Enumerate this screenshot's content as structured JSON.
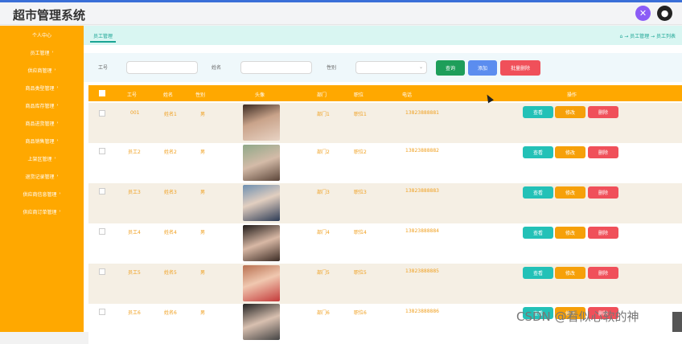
{
  "header": {
    "title": "超市管理系统",
    "settings_icon": "settings-icon",
    "user_icon": "user-icon"
  },
  "sidebar": {
    "items": [
      {
        "label": "个人中心"
      },
      {
        "label": "员工管理"
      },
      {
        "label": "供应商管理"
      },
      {
        "label": "商品类型管理"
      },
      {
        "label": "商品库存管理"
      },
      {
        "label": "商品进货管理"
      },
      {
        "label": "商品销售管理"
      },
      {
        "label": "上架区管理"
      },
      {
        "label": "退货记录管理"
      },
      {
        "label": "供应商信息管理"
      },
      {
        "label": "供应商订单管理"
      }
    ]
  },
  "tabs": {
    "active": "员工管理"
  },
  "breadcrumb": "⌂ → 员工管理 → 员工列表",
  "search": {
    "fields": [
      {
        "label": "工号"
      },
      {
        "label": "姓名"
      },
      {
        "label": "性别"
      }
    ],
    "buttons": [
      {
        "label": "查询"
      },
      {
        "label": "添加"
      },
      {
        "label": "批量删除"
      }
    ]
  },
  "table": {
    "headers": [
      "工号",
      "姓名",
      "性别",
      "头像",
      "部门",
      "职位",
      "电话",
      "操作"
    ],
    "rows": [
      {
        "id": "001",
        "name": "姓名1",
        "gender": "男",
        "dept": "部门1",
        "position": "职位1",
        "phone": "13823888881"
      },
      {
        "id": "员工2",
        "name": "姓名2",
        "gender": "男",
        "dept": "部门2",
        "position": "职位2",
        "phone": "13823888882"
      },
      {
        "id": "员工3",
        "name": "姓名3",
        "gender": "男",
        "dept": "部门3",
        "position": "职位3",
        "phone": "13823888883"
      },
      {
        "id": "员工4",
        "name": "姓名4",
        "gender": "男",
        "dept": "部门4",
        "position": "职位4",
        "phone": "13823888884"
      },
      {
        "id": "员工5",
        "name": "姓名5",
        "gender": "男",
        "dept": "部门5",
        "position": "职位5",
        "phone": "13823888885"
      },
      {
        "id": "员工6",
        "name": "姓名6",
        "gender": "男",
        "dept": "部门6",
        "position": "职位6",
        "phone": "13823888886"
      }
    ],
    "actions": {
      "view": "查看",
      "edit": "修改",
      "delete": "删除"
    }
  },
  "watermark": "CSDN @看似心软的神",
  "colors": {
    "sidebar": "#ffa800",
    "teal": "#23c1b7",
    "orange": "#f6a009",
    "red": "#f0505a",
    "green": "#1e9e5a",
    "blue": "#5b8def"
  }
}
